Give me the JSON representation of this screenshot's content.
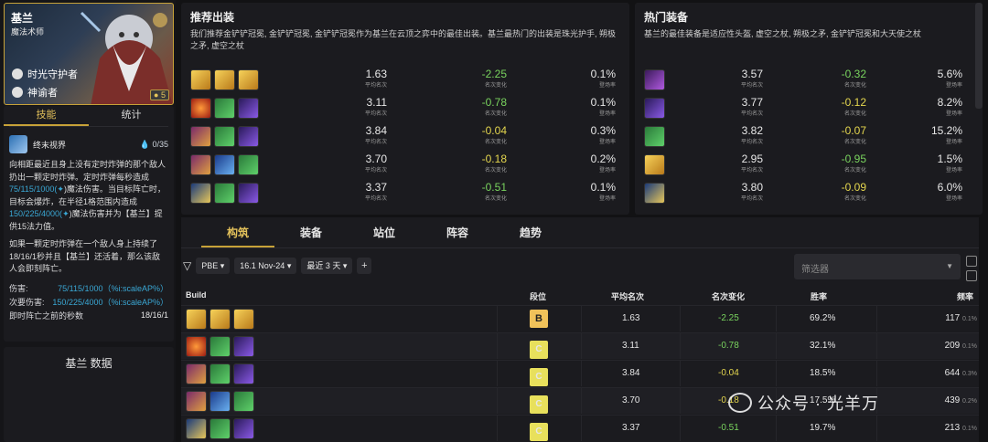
{
  "champion": {
    "name": "基兰",
    "role": "魔法术师",
    "traits": [
      "时光守护者",
      "神谕者"
    ],
    "cost": "5"
  },
  "skill_tabs": [
    "技能",
    "统计"
  ],
  "skill": {
    "name": "终末视界",
    "mana": "0",
    "mana_max": "/35",
    "desc_part1": "向相距最近且身上没有定时炸弹的那个敌人扔出一颗定时炸弹。定时炸弹每秒造成",
    "desc_dmg1": "75/115/1000(",
    "desc_part2": ")魔法伤害。当目标阵亡时，目标会爆炸，在半径1格范围内造成",
    "desc_dmg2": "150/225/4000(",
    "desc_part3": ")魔法伤害并为【基兰】提供15法力值。",
    "desc_second": "如果一颗定时炸弹在一个敌人身上持续了18/16/1秒并且【基兰】还活着，那么该敌人会即刻阵亡。",
    "stats": [
      {
        "label": "伤害:",
        "value": "75/115/1000（%i:scaleAP%）"
      },
      {
        "label": "次要伤害:",
        "value": "150/225/4000（%i:scaleAP%）"
      },
      {
        "label": "即时阵亡之前的秒数",
        "value": "18/16/1"
      }
    ]
  },
  "data_panel_title": "基兰 数据",
  "recommended": {
    "title": "推荐出装",
    "desc": "我们推荐金铲铲冠冕, 金铲铲冠冕, 金铲铲冠冕作为基兰在云顶之弈中的最佳出装。基兰最热门的出装是珠光护手, 朔极之矛, 虚空之杖",
    "rows": [
      {
        "items": [
          "crown-icon",
          "crown-icon",
          "crown-icon"
        ],
        "avg": "1.63",
        "change": "-2.25",
        "rate": "0.1%"
      },
      {
        "items": [
          "fire-orb-icon",
          "green-cloak-icon",
          "void-staff-icon"
        ],
        "avg": "3.11",
        "change": "-0.78",
        "rate": "0.1%"
      },
      {
        "items": [
          "gauntlet-icon",
          "green-cloak-icon",
          "void-staff-icon"
        ],
        "avg": "3.84",
        "change": "-0.04",
        "rate": "0.3%"
      },
      {
        "items": [
          "gauntlet-icon",
          "blue-spear-icon",
          "green-cloak-icon"
        ],
        "avg": "3.70",
        "change": "-0.18",
        "rate": "0.2%"
      },
      {
        "items": [
          "gold-spear-icon",
          "green-cloak-icon",
          "void-staff-icon"
        ],
        "avg": "3.37",
        "change": "-0.51",
        "rate": "0.1%"
      }
    ],
    "label_avg": "平均名次",
    "label_change": "名次变化",
    "label_rate": "登场率"
  },
  "popular": {
    "title": "热门装备",
    "desc": "基兰的最佳装备是适应性头盔, 虚空之杖, 朔极之矛, 金铲铲冠冕和大天使之杖",
    "rows": [
      {
        "item": "purple-helm-icon",
        "avg": "3.57",
        "change": "-0.32",
        "rate": "5.6%"
      },
      {
        "item": "void-staff-icon",
        "avg": "3.77",
        "change": "-0.12",
        "rate": "8.2%"
      },
      {
        "item": "green-cloak-icon",
        "avg": "3.82",
        "change": "-0.07",
        "rate": "15.2%"
      },
      {
        "item": "crown-icon",
        "avg": "2.95",
        "change": "-0.95",
        "rate": "1.5%"
      },
      {
        "item": "gold-spear-icon",
        "avg": "3.80",
        "change": "-0.09",
        "rate": "6.0%"
      }
    ],
    "label_avg": "平均名次",
    "label_change": "名次变化",
    "label_rate": "登场率"
  },
  "bottom_tabs": [
    "构筑",
    "装备",
    "站位",
    "阵容",
    "趋势"
  ],
  "filters": {
    "region": "PBE",
    "patch": "16.1 Nov-24",
    "range": "最近 3 天",
    "search_placeholder": "筛选器"
  },
  "table": {
    "headers": {
      "build": "Build",
      "tier": "段位",
      "avg": "平均名次",
      "change": "名次变化",
      "win": "胜率",
      "freq": "频率"
    },
    "rows": [
      {
        "items": [
          "crown-icon",
          "crown-icon",
          "crown-icon"
        ],
        "tier": "B",
        "avg": "1.63",
        "change": "-2.25",
        "win": "69.2%",
        "freq": "117",
        "freq_pct": "0.1%"
      },
      {
        "items": [
          "fire-orb-icon",
          "green-cloak-icon",
          "void-staff-icon"
        ],
        "tier": "C",
        "avg": "3.11",
        "change": "-0.78",
        "win": "32.1%",
        "freq": "209",
        "freq_pct": "0.1%"
      },
      {
        "items": [
          "gauntlet-icon",
          "green-cloak-icon",
          "void-staff-icon"
        ],
        "tier": "C",
        "avg": "3.84",
        "change": "-0.04",
        "win": "18.5%",
        "freq": "644",
        "freq_pct": "0.3%"
      },
      {
        "items": [
          "gauntlet-icon",
          "blue-spear-icon",
          "green-cloak-icon"
        ],
        "tier": "C",
        "avg": "3.70",
        "change": "-0.18",
        "win": "17.5%",
        "freq": "439",
        "freq_pct": "0.2%"
      },
      {
        "items": [
          "gold-spear-icon",
          "green-cloak-icon",
          "void-staff-icon"
        ],
        "tier": "C",
        "avg": "3.37",
        "change": "-0.51",
        "win": "19.7%",
        "freq": "213",
        "freq_pct": "0.1%"
      }
    ]
  },
  "watermark": "公众号 · 光羊万",
  "colors": {
    "accent": "#c7a238",
    "positive": "#79d35e",
    "warn": "#e4d64e",
    "link": "#3aa7d4"
  }
}
